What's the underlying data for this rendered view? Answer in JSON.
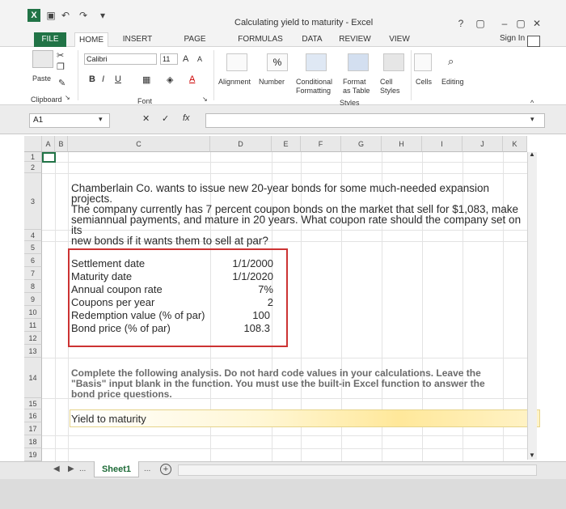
{
  "window": {
    "title": "Calculating yield to maturity - Excel",
    "help": "?",
    "minimize": "–",
    "restore": "▢",
    "close": "✕"
  },
  "tabs": [
    "FILE",
    "HOME",
    "INSERT",
    "PAGE LAYOUT",
    "FORMULAS",
    "DATA",
    "REVIEW",
    "VIEW"
  ],
  "sign_in": "Sign In",
  "ribbon": {
    "paste": "Paste",
    "clipboard": "Clipboard",
    "font_name": "Calibri",
    "font_size": "11",
    "bold": "B",
    "italic": "I",
    "underline": "U",
    "font_group": "Font",
    "alignment": "Alignment",
    "number": "Number",
    "conditional_formatting": "Conditional Formatting",
    "format_as_table": "Format as Table",
    "cell_styles": "Cell Styles",
    "styles_group": "Styles",
    "cells": "Cells",
    "editing": "Editing"
  },
  "formula_bar": {
    "name_box": "A1",
    "cancel": "✕",
    "enter": "✓",
    "fx": "fx",
    "value": ""
  },
  "columns": [
    "A",
    "B",
    "C",
    "D",
    "E",
    "F",
    "G",
    "H",
    "I",
    "J",
    "K"
  ],
  "rows": [
    "1",
    "2",
    "3",
    "4",
    "5",
    "6",
    "7",
    "8",
    "9",
    "10",
    "11",
    "12",
    "13",
    "14",
    "15",
    "16",
    "17",
    "18",
    "19"
  ],
  "cells": {
    "problem_lines": [
      "Chamberlain Co. wants to issue new 20-year bonds for some much-needed expansion projects.",
      "The company currently has 7 percent coupon bonds on the market that sell for $1,083, make",
      "semiannual payments, and mature in 20 years. What coupon rate should the company set on its",
      "new bonds if it wants them to sell at par?"
    ],
    "inputs": [
      {
        "label": "Settlement date",
        "value": "1/1/2000"
      },
      {
        "label": "Maturity date",
        "value": "1/1/2020"
      },
      {
        "label": "Annual coupon rate",
        "value": "7%"
      },
      {
        "label": "Coupons per year",
        "value": "2"
      },
      {
        "label": "Redemption value (% of par)",
        "value": "100"
      },
      {
        "label": "Bond price (% of par)",
        "value": "108.3"
      }
    ],
    "instructions": [
      "Complete the following analysis. Do not hard code values in your calculations. Leave the",
      "\"Basis\" input blank in the function. You must use the built-in Excel function to answer the",
      "bond price questions."
    ],
    "ytm_label": "Yield to maturity"
  },
  "sheet_tabs": {
    "ellipsis_left": "...",
    "sheet1": "Sheet1",
    "ellipsis_right": "...",
    "add": "+"
  }
}
